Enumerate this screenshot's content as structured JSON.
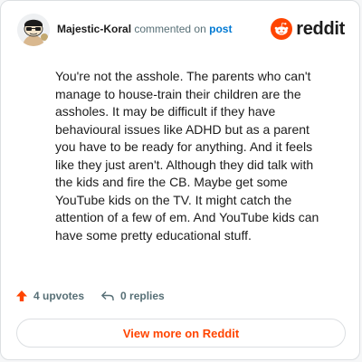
{
  "comment": {
    "username": "Majestic-Koral",
    "commented_on": "commented on",
    "post_link": "post",
    "text": "You're not the asshole. The parents who can't manage to house-train their children are the assholes. It may be difficult if they have behavioural issues like ADHD but as a parent you have to be ready for anything. And it feels like they just aren't. Although they did talk with the kids and fire the CB. Maybe get some YouTube kids on the TV. It might catch the attention of a few of em. And YouTube kids can have some pretty educational stuff."
  },
  "brand": {
    "word": "reddit",
    "icon": "reddit-logo-icon",
    "color": "#ff4500"
  },
  "actions": {
    "upvotes_label": "4 upvotes",
    "replies_label": "0 replies",
    "upvote_icon": "upvote-arrow-icon",
    "reply_icon": "reply-arrow-icon"
  },
  "footer": {
    "view_more_label": "View more on Reddit"
  },
  "colors": {
    "accent": "#ff4500",
    "link": "#0079d3",
    "text": "#1c1c1c",
    "muted": "#576f76"
  }
}
